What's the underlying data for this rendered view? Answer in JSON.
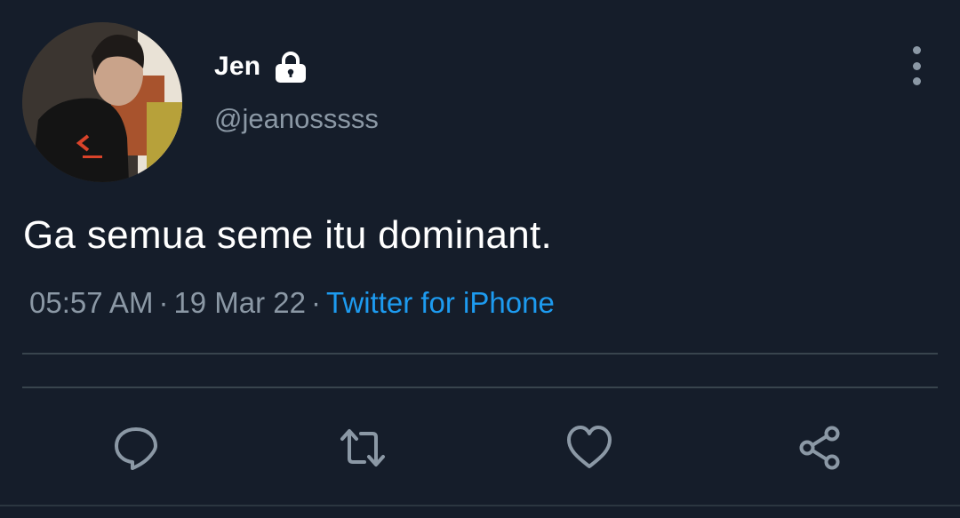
{
  "user": {
    "display_name": "Jen",
    "handle": "@jeanosssss",
    "protected_icon": "lock-icon",
    "avatar": "profile-photo"
  },
  "tweet": {
    "text": "Ga semua seme itu dominant.",
    "time": "05:57 AM",
    "date": "19 Mar 22",
    "separator": "·",
    "source": "Twitter for iPhone"
  },
  "actions": {
    "reply_icon": "reply-icon",
    "retweet_icon": "retweet-icon",
    "like_icon": "heart-icon",
    "share_icon": "share-icon"
  },
  "menu": {
    "icon": "more-vertical-icon"
  },
  "colors": {
    "background": "#151d2a",
    "text_primary": "#ffffff",
    "text_secondary": "#8b98a5",
    "accent": "#1d9bf0",
    "divider": "#38444d"
  }
}
